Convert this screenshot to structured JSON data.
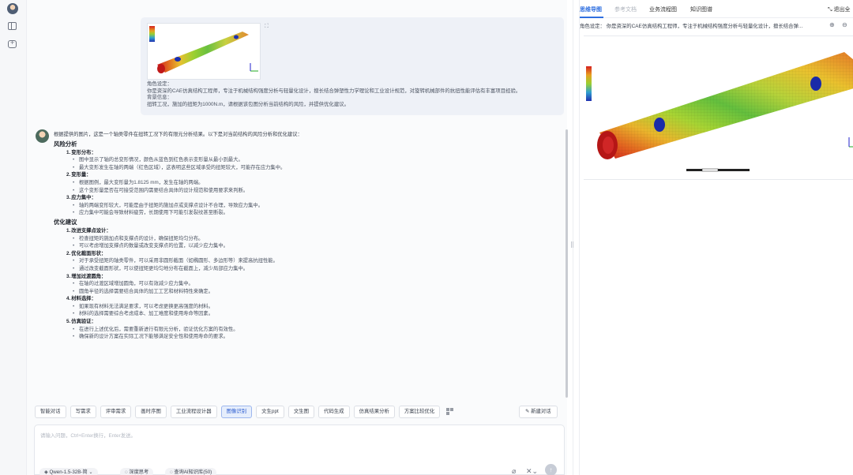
{
  "left_rail": {
    "icons": [
      "user-avatar",
      "panel-toggle-icon",
      "new-chat-icon"
    ]
  },
  "user_message": {
    "copy_icon": "⛶",
    "lines": [
      "角色设定：",
      "你是资深的CAE仿真结构工程师，专注于机械结构强度分析与轻量化设计，擅长结合弹塑性力学理论和工业设计规范，对旋转机械部件的抗扭性能评估有丰富项目经验。",
      "背景信息：",
      "扭转工况，施加的扭矩为1000N.m，请根据该包图分析当前结构的风险，并提供优化建议。"
    ]
  },
  "reply": {
    "intro": "根据提供的图片，这是一个轴类零件在扭转工况下的有限元分析结果。以下是对当前结构的风险分析和优化建议：",
    "sections": [
      {
        "title": "风险分析",
        "items": [
          {
            "num": "1.",
            "title": "变形分布：",
            "bullets": [
              "图中显示了轴的总变形情况，颜色从蓝色到红色表示变形量从最小到最大。",
              "最大变形发生在轴的两端（红色区域），这表明这些区域承受的扭矩较大，可能存在应力集中。"
            ]
          },
          {
            "num": "2.",
            "title": "变形量：",
            "bullets": [
              "根据图例，最大变形量为1.8125 mm，发生在轴的两端。",
              "这个变形量是否在可接受范围内需要结合具体的设计规范和使用要求来判断。"
            ]
          },
          {
            "num": "3.",
            "title": "应力集中：",
            "bullets": [
              "轴的两端变形较大，可能是由于扭矩的施加点或支撑点设计不合理，导致应力集中。",
              "应力集中可能会导致材料疲劳，长期使用下可能引发裂纹甚至断裂。"
            ]
          }
        ]
      },
      {
        "title": "优化建议",
        "items": [
          {
            "num": "1.",
            "title": "改进支撑点设计：",
            "bullets": [
              "检查扭矩的施加点和支撑点的设计，确保扭矩均匀分布。",
              "可以考虑增加支撑点的数量或改变支撑点的位置，以减少应力集中。"
            ]
          },
          {
            "num": "2.",
            "title": "优化截面形状：",
            "bullets": [
              "对于承受扭矩的轴类零件，可以采用非圆形截面（如椭圆形、多边形等）来提高抗扭性能。",
              "通过改变截面形状，可以使扭矩更均匀地分布在截面上，减少局部应力集中。"
            ]
          },
          {
            "num": "3.",
            "title": "增加过渡圆角：",
            "bullets": [
              "在轴的过渡区域增加圆角，可以有效减少应力集中。",
              "圆角半径的选择需要结合具体的加工工艺和材料特性来确定。"
            ]
          },
          {
            "num": "4.",
            "title": "材料选择：",
            "bullets": [
              "如果现有材料无法满足要求，可以考虑更换更高强度的材料。",
              "材料的选择需要综合考虑成本、加工难度和使用寿命等因素。"
            ]
          },
          {
            "num": "5.",
            "title": "仿真验证：",
            "bullets": [
              "在进行上述优化后，需要重新进行有限元分析，验证优化方案的有效性。",
              "确保新的设计方案在实际工况下能够满足安全性和使用寿命的要求。"
            ]
          }
        ]
      }
    ]
  },
  "tools": [
    "智能对话",
    "写需求",
    "评审需求",
    "画时序图",
    "工业流程设计器",
    "图像识别",
    "文生ppt",
    "文生图",
    "代码生成",
    "仿真结果分析",
    "方案比较优化"
  ],
  "active_tool": "图像识别",
  "new_chat_label": "新建对话",
  "input": {
    "placeholder": "请输入问题，Ctrl+Enter换行，Enter发送。",
    "model": "Qwen-1.5-32B-简",
    "deep_think": "深度思考",
    "kb": "查询AI知识库(50)"
  },
  "right_panel": {
    "tabs": [
      "思维导图",
      "参考文档",
      "业务流程图",
      "知识图谱"
    ],
    "active_tab": "思维导图",
    "exit_label": "退出全",
    "role_summary": "角色设定：  你是资深的CAE仿真结构工程师，专注于机械结构强度分析与轻量化设计，擅长结合弹..."
  },
  "colors": {
    "accent": "#2f6fe0",
    "active_tool_bg": "#e6eefc"
  }
}
